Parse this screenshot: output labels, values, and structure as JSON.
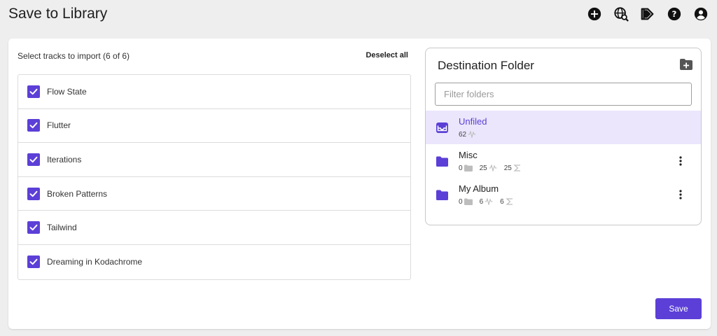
{
  "header": {
    "title": "Save to Library",
    "icons": [
      "add-circle-icon",
      "globe-search-icon",
      "campaign-icon",
      "help-icon",
      "account-icon"
    ]
  },
  "colors": {
    "accent": "#5b3fd6",
    "selected_bg": "#ebe6fb"
  },
  "tracks": {
    "label": "Select tracks to import (6 of 6)",
    "deselect_label": "Deselect all",
    "items": [
      {
        "name": "Flow State",
        "checked": true
      },
      {
        "name": "Flutter",
        "checked": true
      },
      {
        "name": "Iterations",
        "checked": true
      },
      {
        "name": "Broken Patterns",
        "checked": true
      },
      {
        "name": "Tailwind",
        "checked": true
      },
      {
        "name": "Dreaming in Kodachrome",
        "checked": true
      }
    ]
  },
  "destination": {
    "title": "Destination Folder",
    "filter_placeholder": "Filter folders",
    "folders": [
      {
        "name": "Unfiled",
        "tracks": "62",
        "selected": true
      },
      {
        "name": "Misc",
        "subfolders": "0",
        "tracks": "25",
        "total": "25"
      },
      {
        "name": "My Album",
        "subfolders": "0",
        "tracks": "6",
        "total": "6"
      }
    ]
  },
  "footer": {
    "save_label": "Save"
  }
}
